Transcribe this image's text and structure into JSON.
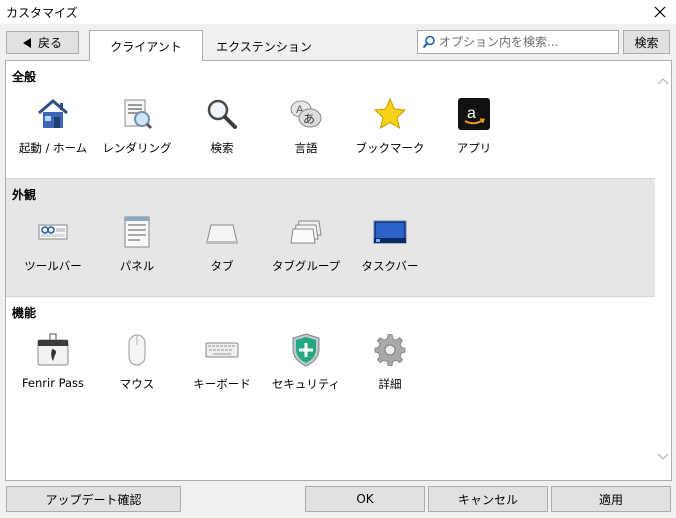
{
  "window": {
    "title": "カスタマイズ"
  },
  "toolbar": {
    "back_label": "戻る",
    "tabs": [
      {
        "label": "クライアント",
        "active": true
      },
      {
        "label": "エクステンション",
        "active": false
      }
    ],
    "search_placeholder": "オプション内を検索...",
    "search_button": "検索"
  },
  "sections": [
    {
      "title": "全般",
      "items": [
        {
          "label": "起動 / ホーム",
          "icon": "home-icon"
        },
        {
          "label": "レンダリング",
          "icon": "rendering-icon"
        },
        {
          "label": "検索",
          "icon": "magnifier-icon"
        },
        {
          "label": "言語",
          "icon": "language-icon"
        },
        {
          "label": "ブックマーク",
          "icon": "star-icon"
        },
        {
          "label": "アプリ",
          "icon": "amazon-app-icon"
        }
      ]
    },
    {
      "title": "外観",
      "items": [
        {
          "label": "ツールバー",
          "icon": "toolbar-icon"
        },
        {
          "label": "パネル",
          "icon": "panel-icon"
        },
        {
          "label": "タブ",
          "icon": "tab-icon"
        },
        {
          "label": "タブグループ",
          "icon": "tab-group-icon"
        },
        {
          "label": "タスクバー",
          "icon": "taskbar-icon"
        }
      ]
    },
    {
      "title": "機能",
      "items": [
        {
          "label": "Fenrir Pass",
          "icon": "fenrir-pass-icon"
        },
        {
          "label": "マウス",
          "icon": "mouse-icon"
        },
        {
          "label": "キーボード",
          "icon": "keyboard-icon"
        },
        {
          "label": "セキュリティ",
          "icon": "security-shield-icon"
        },
        {
          "label": "詳細",
          "icon": "gear-icon"
        }
      ]
    }
  ],
  "footer": {
    "update_label": "アップデート確認",
    "ok_label": "OK",
    "cancel_label": "キャンセル",
    "apply_label": "適用"
  },
  "colors": {
    "window_bg": "#f0f0f0",
    "button_bg": "#e1e1e1",
    "section_alt_bg": "#e6e6e6",
    "accent_blue": "#1f5ea8"
  }
}
